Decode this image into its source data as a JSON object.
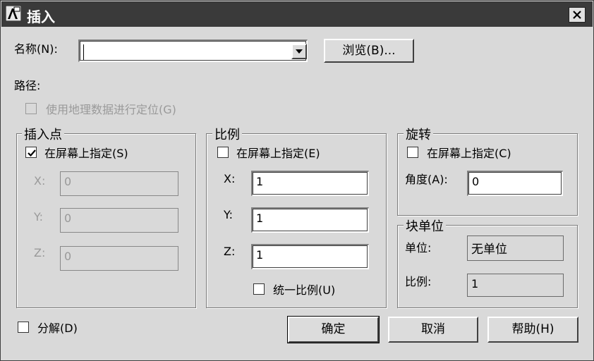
{
  "window": {
    "title": "插入"
  },
  "name_row": {
    "label": "名称(N):",
    "value": "",
    "browse_label": "浏览(B)..."
  },
  "path": {
    "label": "路径:"
  },
  "geo": {
    "label": "使用地理数据进行定位(G)",
    "checked": false,
    "enabled": false
  },
  "insertion_point": {
    "title": "插入点",
    "on_screen_label": "在屏幕上指定(S)",
    "on_screen_checked": true,
    "x_label": "X:",
    "x_value": "0",
    "y_label": "Y:",
    "y_value": "0",
    "z_label": "Z:",
    "z_value": "0"
  },
  "scale": {
    "title": "比例",
    "on_screen_label": "在屏幕上指定(E)",
    "on_screen_checked": false,
    "x_label": "X:",
    "x_value": "1",
    "y_label": "Y:",
    "y_value": "1",
    "z_label": "Z:",
    "z_value": "1",
    "uniform_label": "统一比例(U)",
    "uniform_checked": false
  },
  "rotation": {
    "title": "旋转",
    "on_screen_label": "在屏幕上指定(C)",
    "on_screen_checked": false,
    "angle_label": "角度(A):",
    "angle_value": "0"
  },
  "block_unit": {
    "title": "块单位",
    "unit_label": "单位:",
    "unit_value": "无单位",
    "factor_label": "比例:",
    "factor_value": "1"
  },
  "explode": {
    "label": "分解(D)",
    "checked": false
  },
  "buttons": {
    "ok": "确定",
    "cancel": "取消",
    "help": "帮助(H)"
  },
  "icons": {
    "app": "autocad-icon",
    "close": "close-icon",
    "dropdown": "chevron-down-icon",
    "check": "checkmark-icon"
  }
}
